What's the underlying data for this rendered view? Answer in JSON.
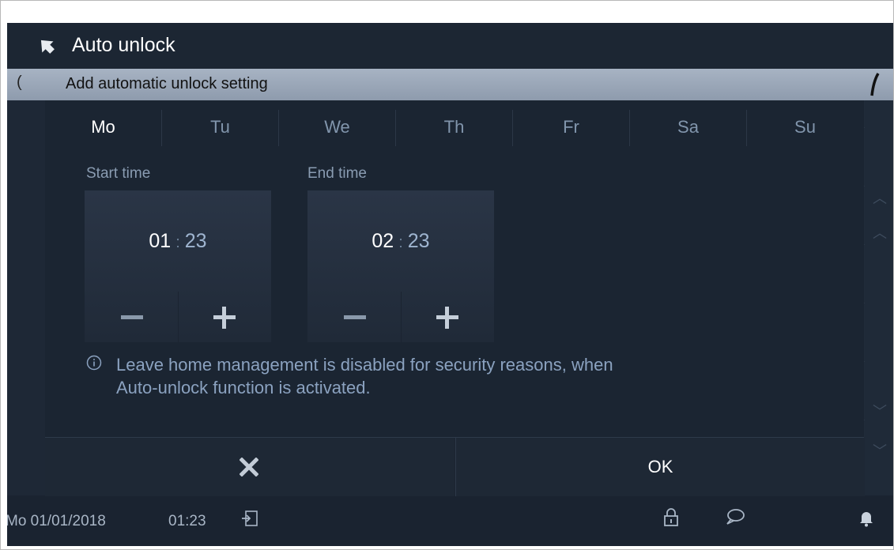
{
  "header": {
    "title": "Auto unlock",
    "back_icon": "arrow-up-left-icon"
  },
  "dialog": {
    "title": "Add automatic unlock setting",
    "days": [
      {
        "label": "Mo",
        "selected": true
      },
      {
        "label": "Tu",
        "selected": false
      },
      {
        "label": "We",
        "selected": false
      },
      {
        "label": "Th",
        "selected": false
      },
      {
        "label": "Fr",
        "selected": false
      },
      {
        "label": "Sa",
        "selected": false
      },
      {
        "label": "Su",
        "selected": false
      }
    ],
    "start": {
      "label": "Start time",
      "hour": "01",
      "minute": "23",
      "separator": ":"
    },
    "end": {
      "label": "End time",
      "hour": "02",
      "minute": "23",
      "separator": ":"
    },
    "info_line1": "Leave home management is disabled for security reasons, when",
    "info_line2": "Auto-unlock function is activated.",
    "ok_label": "OK"
  },
  "status": {
    "date": "Mo 01/01/2018",
    "time": "01:23"
  },
  "colors": {
    "background": "#1a2330",
    "header_bar": "#9aa7b8",
    "text_primary": "#ffffff",
    "text_secondary": "#8ba2c0"
  }
}
